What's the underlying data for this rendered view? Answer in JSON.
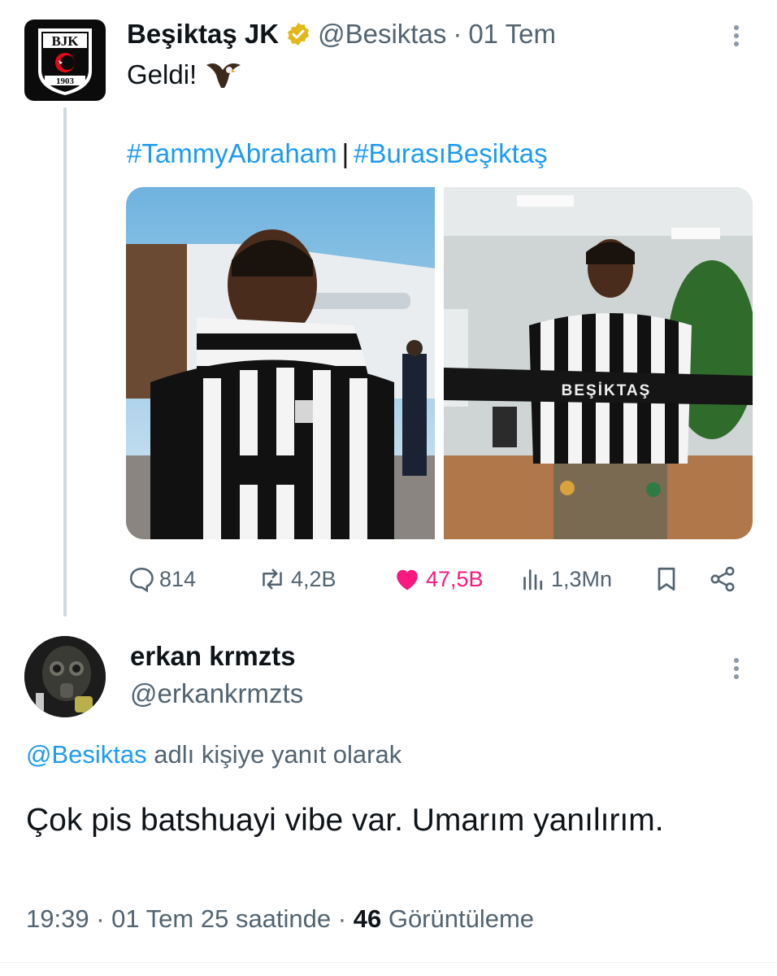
{
  "parent_tweet": {
    "author_name": "Beşiktaş JK",
    "handle": "@Besiktas",
    "separator": "·",
    "date": "01 Tem",
    "text": "Geldi!",
    "hashtags": [
      "#TammyAbraham",
      "#BurasıBeşiktaş"
    ],
    "hashtag_separator": "|",
    "logo": {
      "letters": "BJK",
      "year": "1903"
    },
    "photos": [
      {
        "icon": "player-by-jet-photo"
      },
      {
        "icon": "player-with-scarf-photo",
        "scarf_text": "BEŞİKTAŞ"
      }
    ],
    "actions": {
      "replies": "814",
      "reposts": "4,2B",
      "likes": "47,5B",
      "views": "1,3Mn"
    }
  },
  "reply_tweet": {
    "author_name": "erkan krmzts",
    "handle": "@erkankrmzts",
    "replying_to_mention": "@Besiktas",
    "replying_to_suffix": " adlı kişiye yanıt olarak",
    "text": "Çok pis batshuayi vibe var.  Umarım yanılırım.",
    "time": "19:39",
    "date_suffix": "· 01 Tem 25 saatinde ·",
    "view_count": "46",
    "view_label": "Görüntüleme"
  },
  "colors": {
    "accent": "#1d9bf0",
    "like": "#f91880",
    "muted": "#536471",
    "verified_gold": "#e2b719"
  }
}
